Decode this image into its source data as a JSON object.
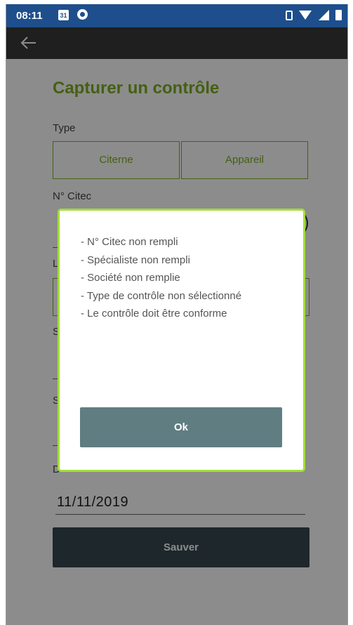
{
  "status_bar": {
    "time": "08:11",
    "calendar_day": "31"
  },
  "form": {
    "title": "Capturer un contrôle",
    "type_label": "Type",
    "type_options": [
      "Citerne",
      "Appareil"
    ],
    "citec_label": "N° Citec",
    "partial_labels": [
      "L",
      "S",
      "S",
      "D"
    ],
    "date_value": "11/11/2019",
    "save_label": "Sauver"
  },
  "dialog": {
    "messages": [
      "- N° Citec non rempli",
      "- Spécialiste non rempli",
      "- Société non remplie",
      "- Type de contrôle non sélectionné",
      "- Le contrôle doit être conforme"
    ],
    "ok_label": "Ok"
  },
  "colors": {
    "accent": "#7cb021",
    "status_bar": "#1e4f8c",
    "toolbar": "#3a3a3a",
    "save_button": "#37474f",
    "ok_button": "#607d82",
    "dialog_border": "#a4dd3a"
  }
}
